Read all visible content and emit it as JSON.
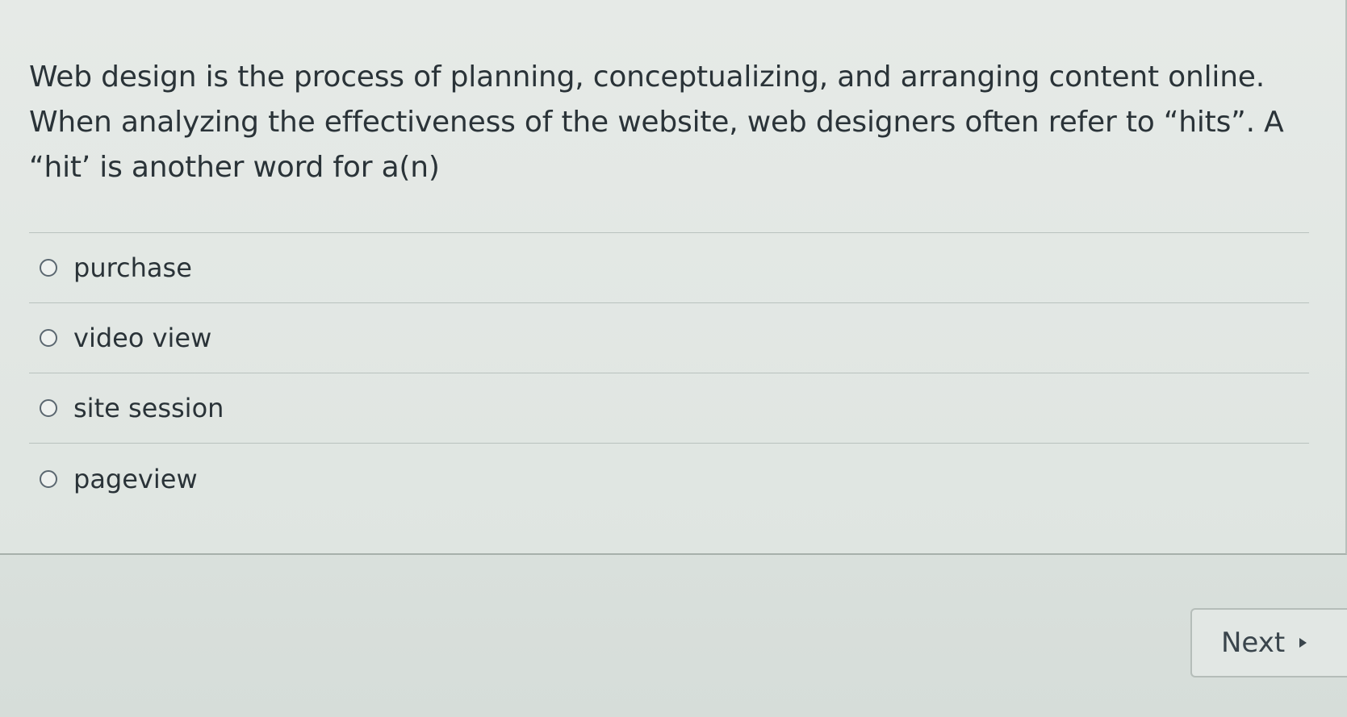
{
  "question": {
    "text": "Web design is the process of planning, conceptualizing, and arranging content online.  When analyzing the effectiveness of the website, web designers often refer to “hits”.  A “hit’ is another word for a(n)"
  },
  "answers": [
    {
      "label": "purchase",
      "selected": false
    },
    {
      "label": "video view",
      "selected": false
    },
    {
      "label": "site session",
      "selected": false
    },
    {
      "label": "pageview",
      "selected": false
    }
  ],
  "navigation": {
    "next_label": "Next",
    "next_icon": "triangle-right-icon"
  }
}
